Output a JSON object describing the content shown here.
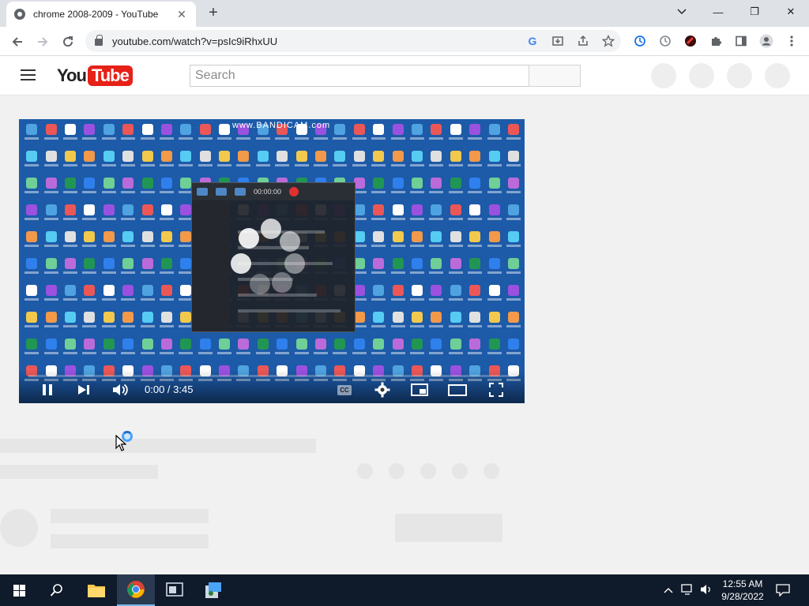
{
  "browser": {
    "tab_title": "chrome 2008-2009 - YouTube",
    "tab_close": "✕",
    "new_tab": "+",
    "window_minimize": "—",
    "window_restore": "❐",
    "window_close": "✕",
    "url": "youtube.com/watch?v=psIc9iRhxUU"
  },
  "youtube": {
    "logo_you": "You",
    "logo_tube": "Tube",
    "search_placeholder": "Search",
    "brand_color": "#e62117"
  },
  "player": {
    "watermark": "www.BANDICAM.com",
    "bandicam_timer": "00:00:00",
    "time_current": "0:00",
    "time_total": "3:45",
    "time_display": "0:00 / 3:45",
    "cc_label": "CC",
    "progress_fraction": 0.0,
    "progress_color": "#ff0000"
  },
  "taskbar": {
    "time": "12:55 AM",
    "date": "9/28/2022"
  }
}
